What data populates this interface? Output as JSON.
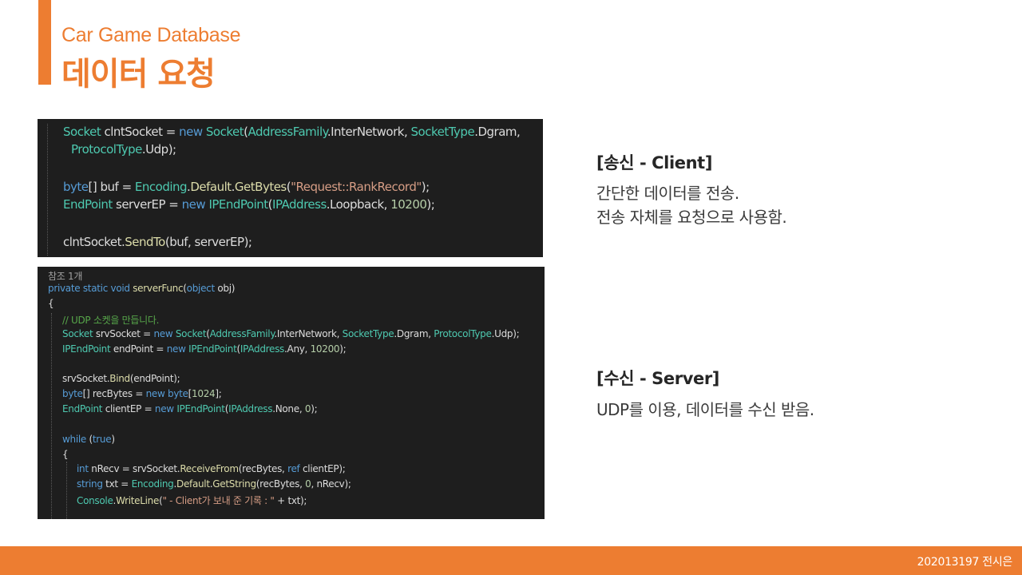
{
  "header": {
    "subtitle": "Car Game Database",
    "title": "데이터 요청"
  },
  "client_code": {
    "lines": [
      [
        [
          "ty",
          "Socket"
        ],
        [
          "vr",
          " clntSocket = "
        ],
        [
          "kw",
          "new"
        ],
        [
          "vr",
          " "
        ],
        [
          "ty",
          "Socket"
        ],
        [
          "vr",
          "("
        ],
        [
          "ty",
          "AddressFamily"
        ],
        [
          "vr",
          ".InterNetwork, "
        ],
        [
          "ty",
          "SocketType"
        ],
        [
          "vr",
          ".Dgram,"
        ]
      ],
      [
        [
          "ty",
          "ProtocolType"
        ],
        [
          "vr",
          ".Udp);"
        ]
      ],
      [
        [
          "kw",
          "byte"
        ],
        [
          "vr",
          "[] buf = "
        ],
        [
          "ty",
          "Encoding"
        ],
        [
          "vr",
          "."
        ],
        [
          "mt",
          "Default"
        ],
        [
          "vr",
          "."
        ],
        [
          "mt",
          "GetBytes"
        ],
        [
          "vr",
          "("
        ],
        [
          "st",
          "\"Request::RankRecord\""
        ],
        [
          "vr",
          ");"
        ]
      ],
      [
        [
          "ty",
          "EndPoint"
        ],
        [
          "vr",
          " serverEP = "
        ],
        [
          "kw",
          "new"
        ],
        [
          "vr",
          " "
        ],
        [
          "ty",
          "IPEndPoint"
        ],
        [
          "vr",
          "("
        ],
        [
          "ty",
          "IPAddress"
        ],
        [
          "vr",
          ".Loopback, "
        ],
        [
          "nm",
          "10200"
        ],
        [
          "vr",
          ");"
        ]
      ],
      [
        [
          "vr",
          "clntSocket."
        ],
        [
          "mt",
          "SendTo"
        ],
        [
          "vr",
          "(buf, serverEP);"
        ]
      ]
    ]
  },
  "server_code": {
    "ref_label": "참조 1개",
    "lines": [
      [
        [
          "kw",
          "private"
        ],
        [
          "vr",
          " "
        ],
        [
          "kw",
          "static"
        ],
        [
          "vr",
          " "
        ],
        [
          "kw",
          "void"
        ],
        [
          "vr",
          " "
        ],
        [
          "mt",
          "serverFunc"
        ],
        [
          "vr",
          "("
        ],
        [
          "kw",
          "object"
        ],
        [
          "vr",
          " obj)"
        ]
      ],
      [
        [
          "vr",
          "{"
        ]
      ],
      [
        [
          "cm",
          "// UDP 소켓을 만듭니다."
        ]
      ],
      [
        [
          "ty",
          "Socket"
        ],
        [
          "vr",
          " srvSocket = "
        ],
        [
          "kw",
          "new"
        ],
        [
          "vr",
          " "
        ],
        [
          "ty",
          "Socket"
        ],
        [
          "vr",
          "("
        ],
        [
          "ty",
          "AddressFamily"
        ],
        [
          "vr",
          ".InterNetwork, "
        ],
        [
          "ty",
          "SocketType"
        ],
        [
          "vr",
          ".Dgram, "
        ],
        [
          "ty",
          "ProtocolType"
        ],
        [
          "vr",
          ".Udp);"
        ]
      ],
      [
        [
          "ty",
          "IPEndPoint"
        ],
        [
          "vr",
          " endPoint = "
        ],
        [
          "kw",
          "new"
        ],
        [
          "vr",
          " "
        ],
        [
          "ty",
          "IPEndPoint"
        ],
        [
          "vr",
          "("
        ],
        [
          "ty",
          "IPAddress"
        ],
        [
          "vr",
          ".Any, "
        ],
        [
          "nm",
          "10200"
        ],
        [
          "vr",
          ");"
        ]
      ],
      [
        [
          "vr",
          "srvSocket."
        ],
        [
          "mt",
          "Bind"
        ],
        [
          "vr",
          "(endPoint);"
        ]
      ],
      [
        [
          "kw",
          "byte"
        ],
        [
          "vr",
          "[] recBytes = "
        ],
        [
          "kw",
          "new"
        ],
        [
          "vr",
          " "
        ],
        [
          "kw",
          "byte"
        ],
        [
          "vr",
          "["
        ],
        [
          "nm",
          "1024"
        ],
        [
          "vr",
          "];"
        ]
      ],
      [
        [
          "ty",
          "EndPoint"
        ],
        [
          "vr",
          " clientEP = "
        ],
        [
          "kw",
          "new"
        ],
        [
          "vr",
          " "
        ],
        [
          "ty",
          "IPEndPoint"
        ],
        [
          "vr",
          "("
        ],
        [
          "ty",
          "IPAddress"
        ],
        [
          "vr",
          ".None, "
        ],
        [
          "nm",
          "0"
        ],
        [
          "vr",
          ");"
        ]
      ],
      [
        [
          "kw",
          "while"
        ],
        [
          "vr",
          " ("
        ],
        [
          "kw",
          "true"
        ],
        [
          "vr",
          ")"
        ]
      ],
      [
        [
          "vr",
          "{"
        ]
      ],
      [
        [
          "kw",
          "int"
        ],
        [
          "vr",
          " nRecv = srvSocket."
        ],
        [
          "mt",
          "ReceiveFrom"
        ],
        [
          "vr",
          "(recBytes, "
        ],
        [
          "kw",
          "ref"
        ],
        [
          "vr",
          " clientEP);"
        ]
      ],
      [
        [
          "kw",
          "string"
        ],
        [
          "vr",
          " txt = "
        ],
        [
          "ty",
          "Encoding"
        ],
        [
          "vr",
          "."
        ],
        [
          "mt",
          "Default"
        ],
        [
          "vr",
          "."
        ],
        [
          "mt",
          "GetString"
        ],
        [
          "vr",
          "(recBytes, "
        ],
        [
          "nm",
          "0"
        ],
        [
          "vr",
          ", nRecv);"
        ]
      ],
      [
        [
          "ty",
          "Console"
        ],
        [
          "vr",
          "."
        ],
        [
          "mt",
          "WriteLine"
        ],
        [
          "vr",
          "("
        ],
        [
          "st",
          "\" - Client가 보내 준 기록 : \""
        ],
        [
          "vr",
          " + txt);"
        ]
      ]
    ]
  },
  "client_section": {
    "heading": "[송신 - Client]",
    "line1": "간단한 데이터를 전송.",
    "line2": "전송 자체를 요청으로 사용함."
  },
  "server_section": {
    "heading": "[수신 - Server]",
    "line1": "UDP를 이용, 데이터를 수신 받음."
  },
  "footer": {
    "text": "202013197 전시은"
  },
  "colors": {
    "accent": "#ED7D31",
    "code_background": "#1E1E1E"
  }
}
